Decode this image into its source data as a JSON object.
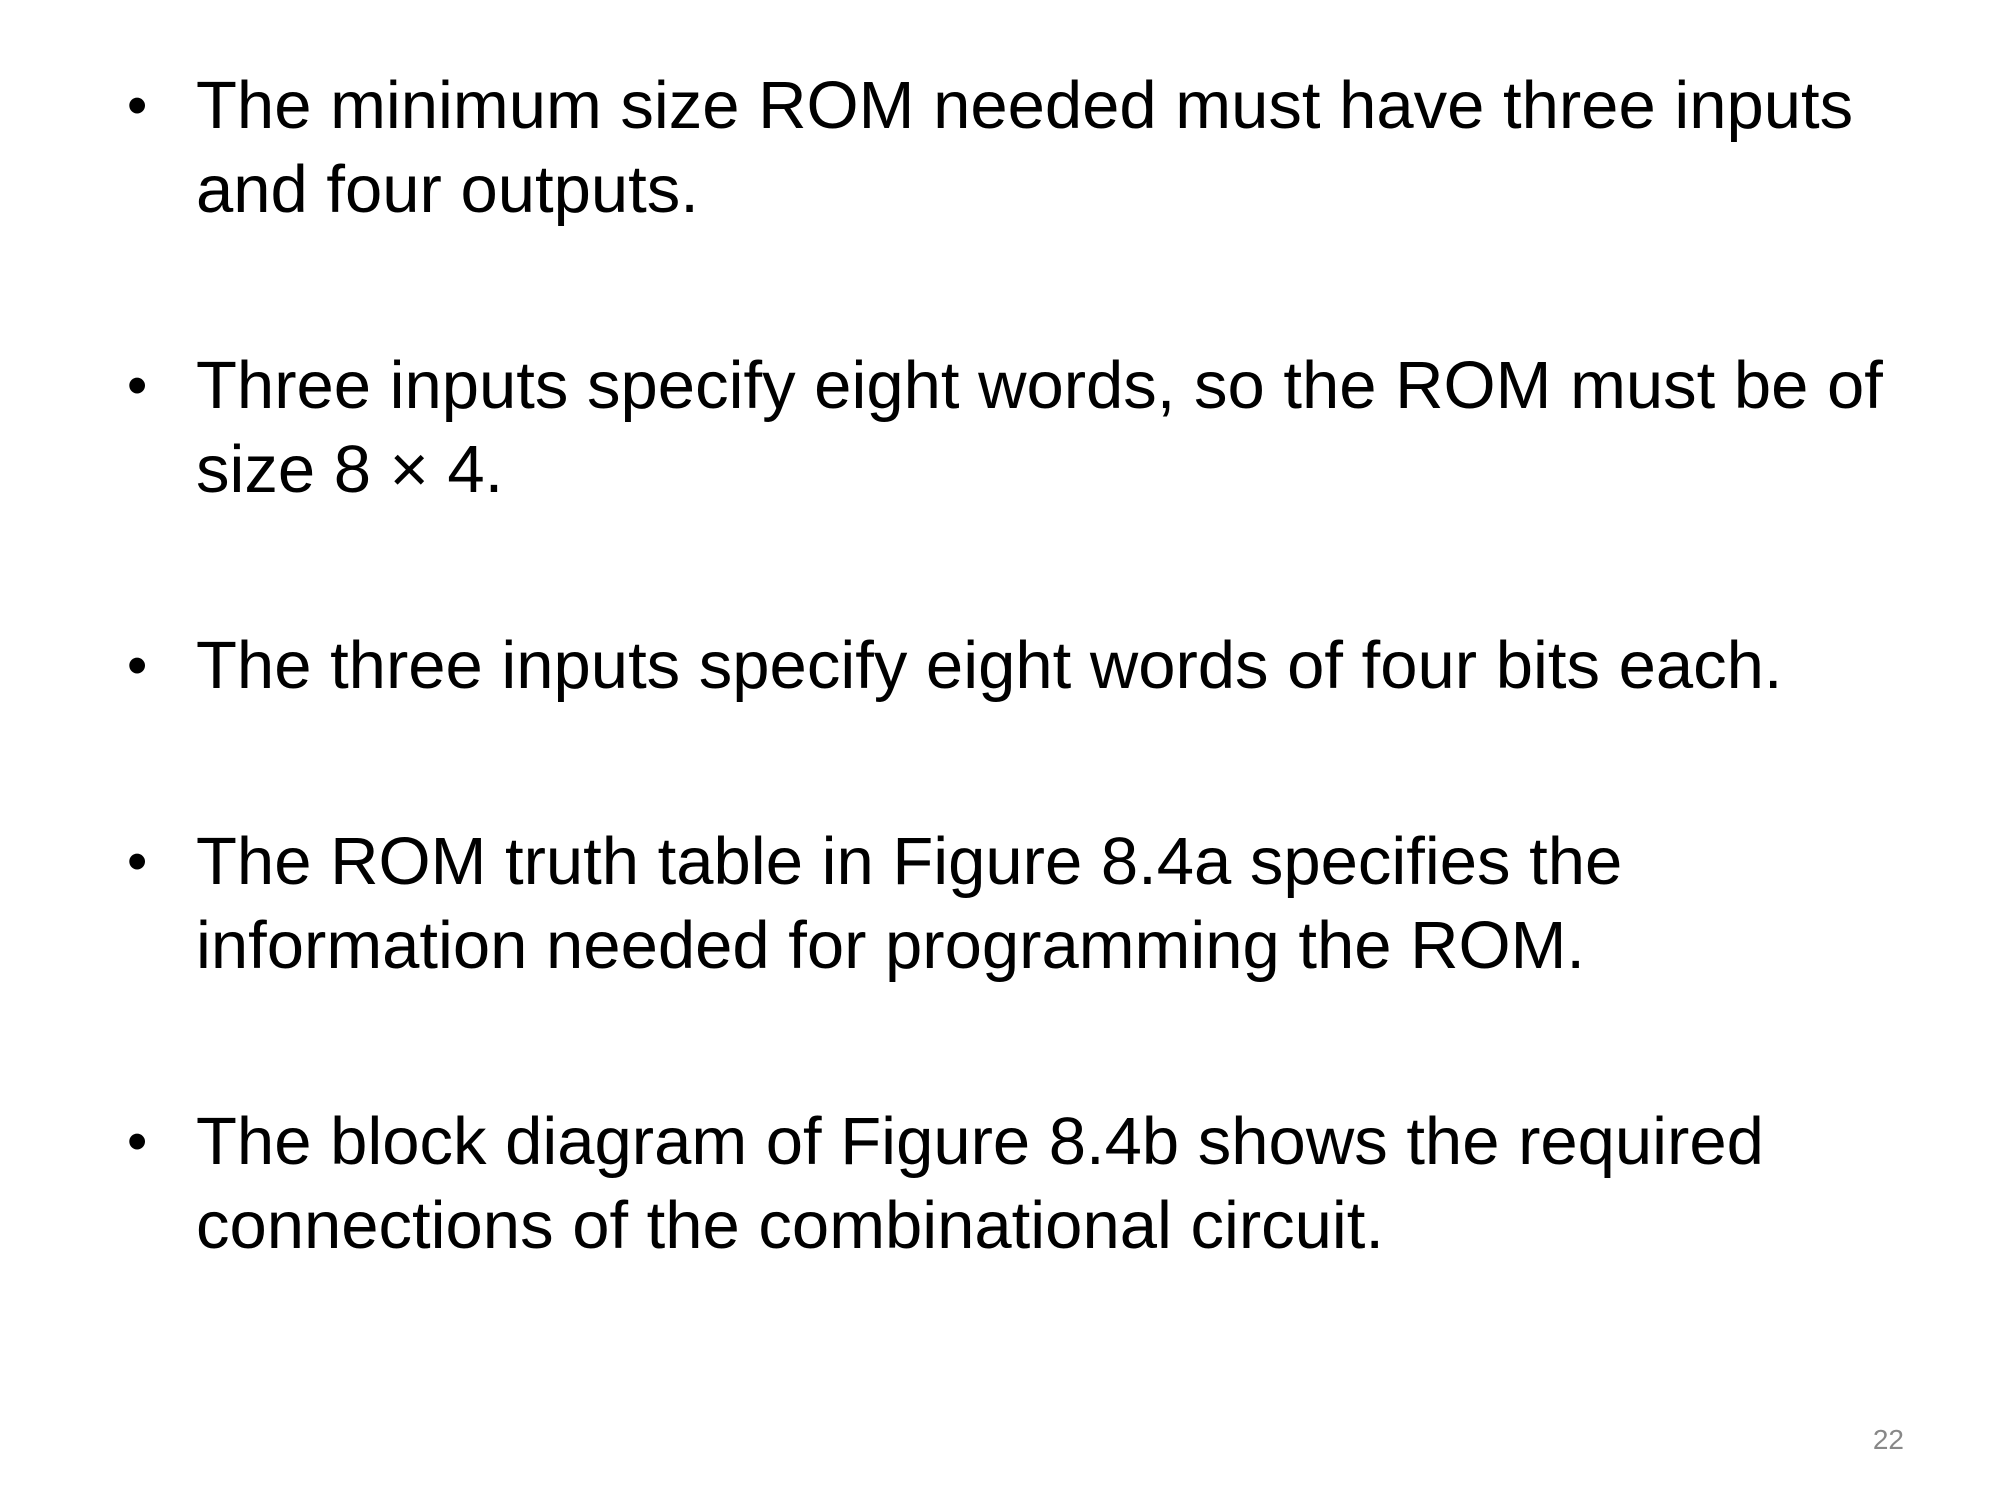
{
  "slide": {
    "bullet_glyph": "•",
    "bullets": [
      {
        "text": "The minimum size ROM needed must have three inputs and four outputs."
      },
      {
        "text": "Three inputs specify eight words, so the ROM must be of size 8 × 4."
      },
      {
        "text": "The three inputs specify eight words of four bits each."
      },
      {
        "text": "The ROM truth table in Figure 8.4a specifies the information needed for programming the ROM."
      },
      {
        "text": "The block diagram of Figure 8.4b shows the required connections of the combinational circuit."
      }
    ],
    "page_number": "22"
  }
}
